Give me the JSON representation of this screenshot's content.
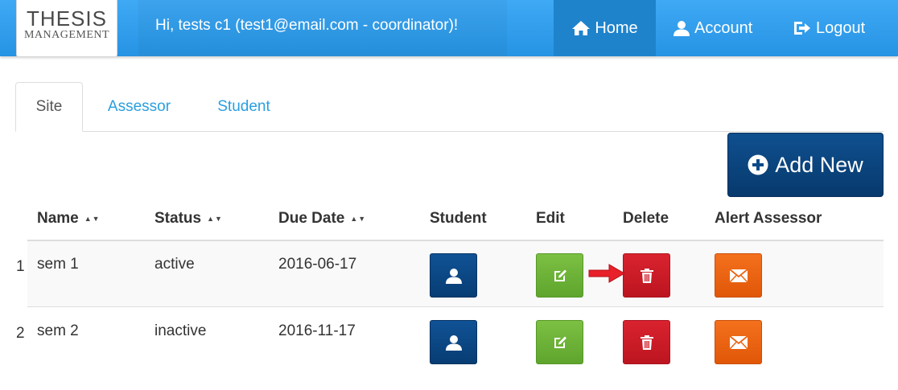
{
  "header": {
    "logo_line1": "THESIS",
    "logo_line2": "MANAGEMENT",
    "greeting": "Hi, tests c1 (test1@email.com - coordinator)!",
    "nav": [
      {
        "label": "Home",
        "icon": "home-icon",
        "active": true
      },
      {
        "label": "Account",
        "icon": "user-icon",
        "active": false
      },
      {
        "label": "Logout",
        "icon": "logout-icon",
        "active": false
      }
    ],
    "bar_color": "#2f9de8"
  },
  "tabs": [
    {
      "label": "Site",
      "active": true
    },
    {
      "label": "Assessor",
      "active": false
    },
    {
      "label": "Student",
      "active": false
    }
  ],
  "add_button": {
    "label": "Add New",
    "icon": "plus-circle-icon"
  },
  "table": {
    "columns": [
      {
        "label": "Name",
        "sortable": true
      },
      {
        "label": "Status",
        "sortable": true
      },
      {
        "label": "Due Date",
        "sortable": true
      },
      {
        "label": "Student",
        "sortable": false
      },
      {
        "label": "Edit",
        "sortable": false
      },
      {
        "label": "Delete",
        "sortable": false
      },
      {
        "label": "Alert Assessor",
        "sortable": false
      }
    ],
    "sort_glyph": "▲▼",
    "rows": [
      {
        "index": "1",
        "name": "sem 1",
        "status": "active",
        "due_date": "2016-06-17"
      },
      {
        "index": "2",
        "name": "sem 2",
        "status": "inactive",
        "due_date": "2016-11-17"
      }
    ],
    "action_icons": {
      "student": "user-icon",
      "edit": "edit-icon",
      "delete": "trash-icon",
      "alert": "envelope-icon"
    },
    "colors": {
      "student": "#0b4a87",
      "edit": "#6db536",
      "delete": "#cc1d28",
      "alert": "#ec6412"
    }
  },
  "annotation": {
    "icon": "red-arrow-icon",
    "color": "#e8202a"
  }
}
